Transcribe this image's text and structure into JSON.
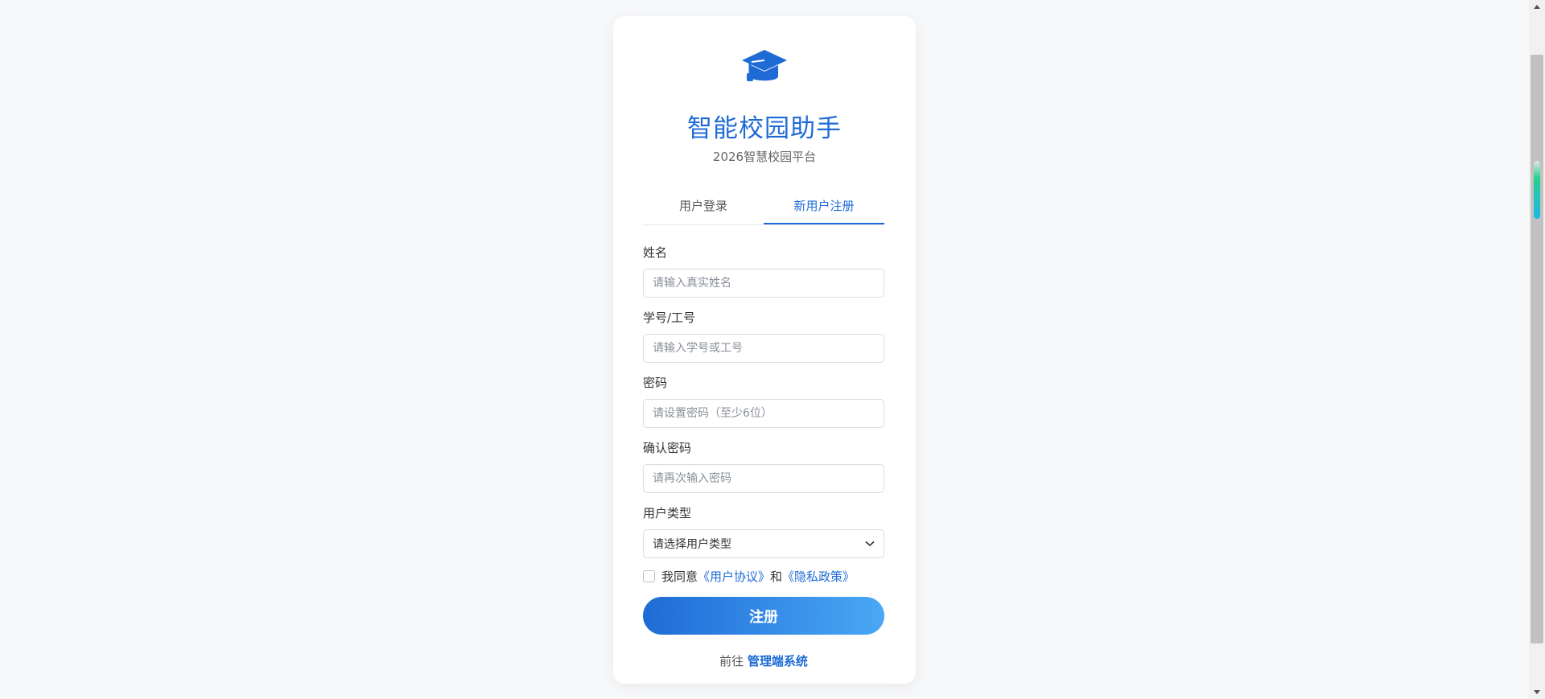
{
  "app": {
    "title": "智能校园助手",
    "subtitle": "2026智慧校园平台",
    "logo_icon": "graduation-cap-icon",
    "accent_color": "#1e6bd6"
  },
  "tabs": [
    {
      "label": "用户登录",
      "active": false
    },
    {
      "label": "新用户注册",
      "active": true
    }
  ],
  "form": {
    "name": {
      "label": "姓名",
      "placeholder": "请输入真实姓名",
      "value": ""
    },
    "student_id": {
      "label": "学号/工号",
      "placeholder": "请输入学号或工号",
      "value": ""
    },
    "password": {
      "label": "密码",
      "placeholder": "请设置密码（至少6位）",
      "value": ""
    },
    "confirm_password": {
      "label": "确认密码",
      "placeholder": "请再次输入密码",
      "value": ""
    },
    "user_type": {
      "label": "用户类型",
      "selected": "请选择用户类型"
    },
    "agreement": {
      "prefix": "我同意",
      "user_agreement": "《用户协议》",
      "conjunction": "和",
      "privacy_policy": "《隐私政策》",
      "checked": false
    },
    "submit_label": "注册"
  },
  "footer": {
    "prefix": "前往",
    "admin_link": "管理端系统"
  }
}
